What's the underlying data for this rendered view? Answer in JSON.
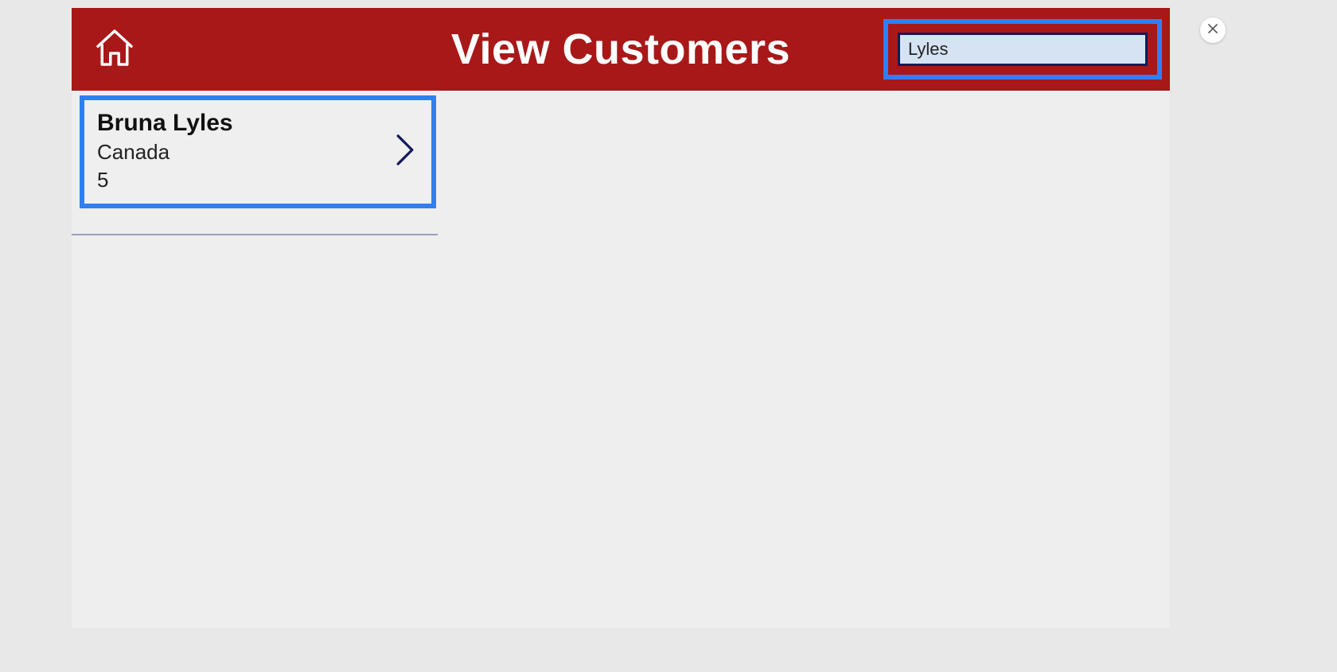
{
  "header": {
    "title": "View Customers",
    "search_value": "Lyles"
  },
  "results": [
    {
      "name": "Bruna  Lyles",
      "country": "Canada",
      "id": "5"
    }
  ],
  "colors": {
    "header_bg": "#a81818",
    "highlight_border": "#2f7ff3",
    "input_bg": "#d6e3f3",
    "input_border": "#151a5c"
  }
}
